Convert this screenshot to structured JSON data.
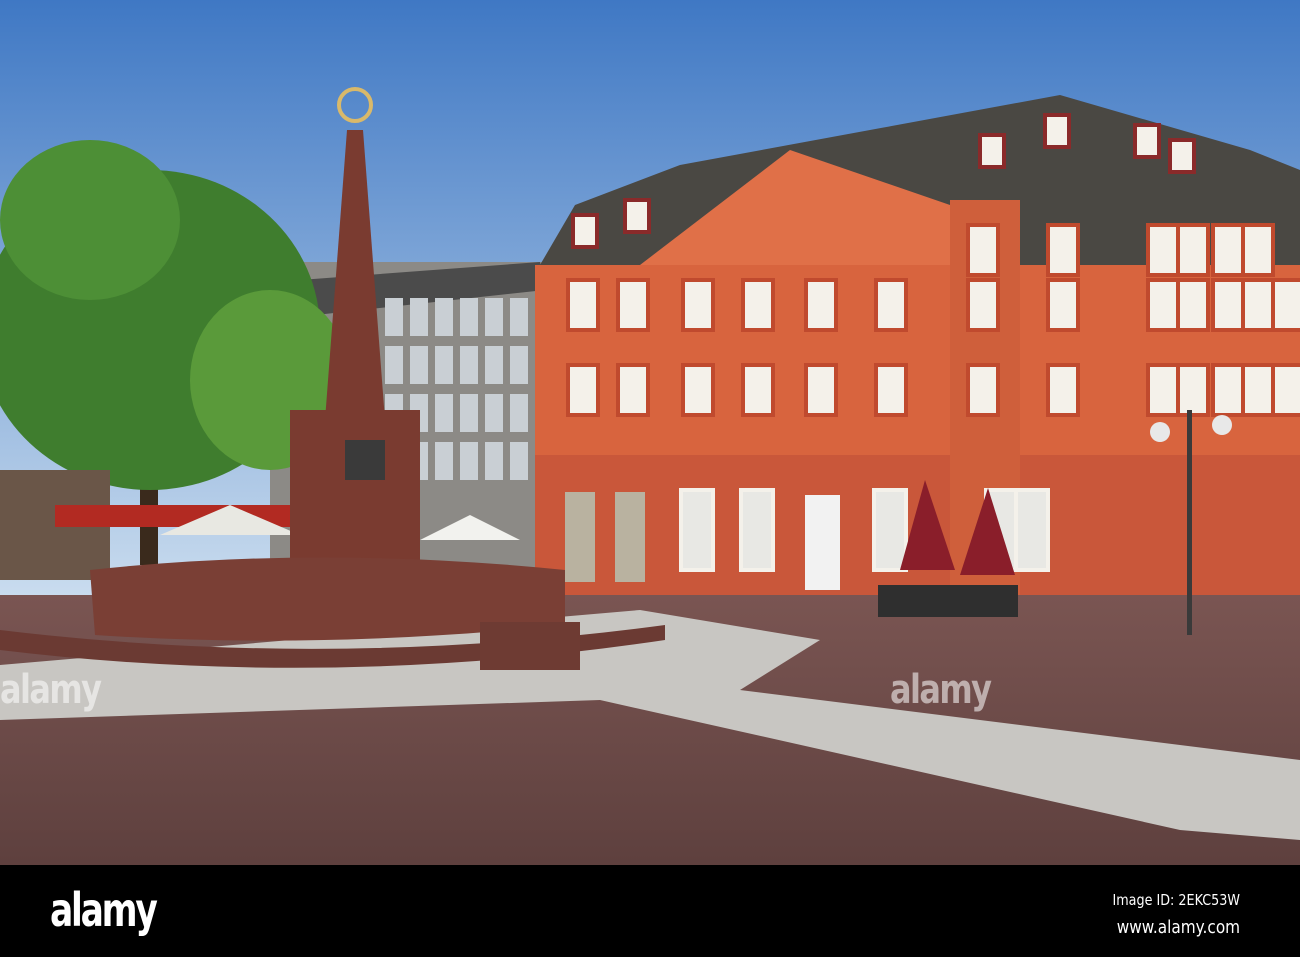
{
  "photo": {
    "subject": "Town square with fountain obelisk and baroque orange building",
    "colors": {
      "sky_top": "#3f78c4",
      "sky_bottom": "#c9dcef",
      "facade": "#d8643e",
      "facade_light": "#f3e4cf",
      "roof": "#4a4843",
      "pavement": "#6e4a47",
      "paving_light": "#c8c6c2",
      "tree": "#3f7d2e",
      "stone": "#7a3b30"
    }
  },
  "watermark": {
    "text": "alamy"
  },
  "footer": {
    "logo": "alamy",
    "image_id": "Image ID: 2EKC53W",
    "url": "www.alamy.com"
  }
}
